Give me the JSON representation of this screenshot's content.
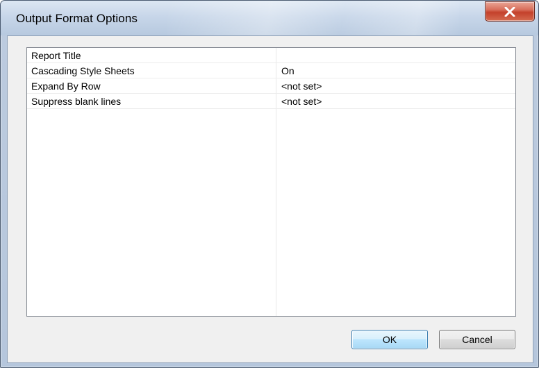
{
  "window": {
    "title": "Output Format Options"
  },
  "titlebar": {
    "close_icon": "close-x-icon"
  },
  "properties": {
    "rows": [
      {
        "name": "Report Title",
        "value": ""
      },
      {
        "name": "Cascading Style Sheets",
        "value": "On"
      },
      {
        "name": "Expand By Row",
        "value": "<not set>"
      },
      {
        "name": "Suppress blank lines",
        "value": "<not set>"
      }
    ]
  },
  "buttons": {
    "ok_label": "OK",
    "cancel_label": "Cancel"
  },
  "colors": {
    "close_button": "#c4412b",
    "default_button_border": "#3c7fb1"
  }
}
